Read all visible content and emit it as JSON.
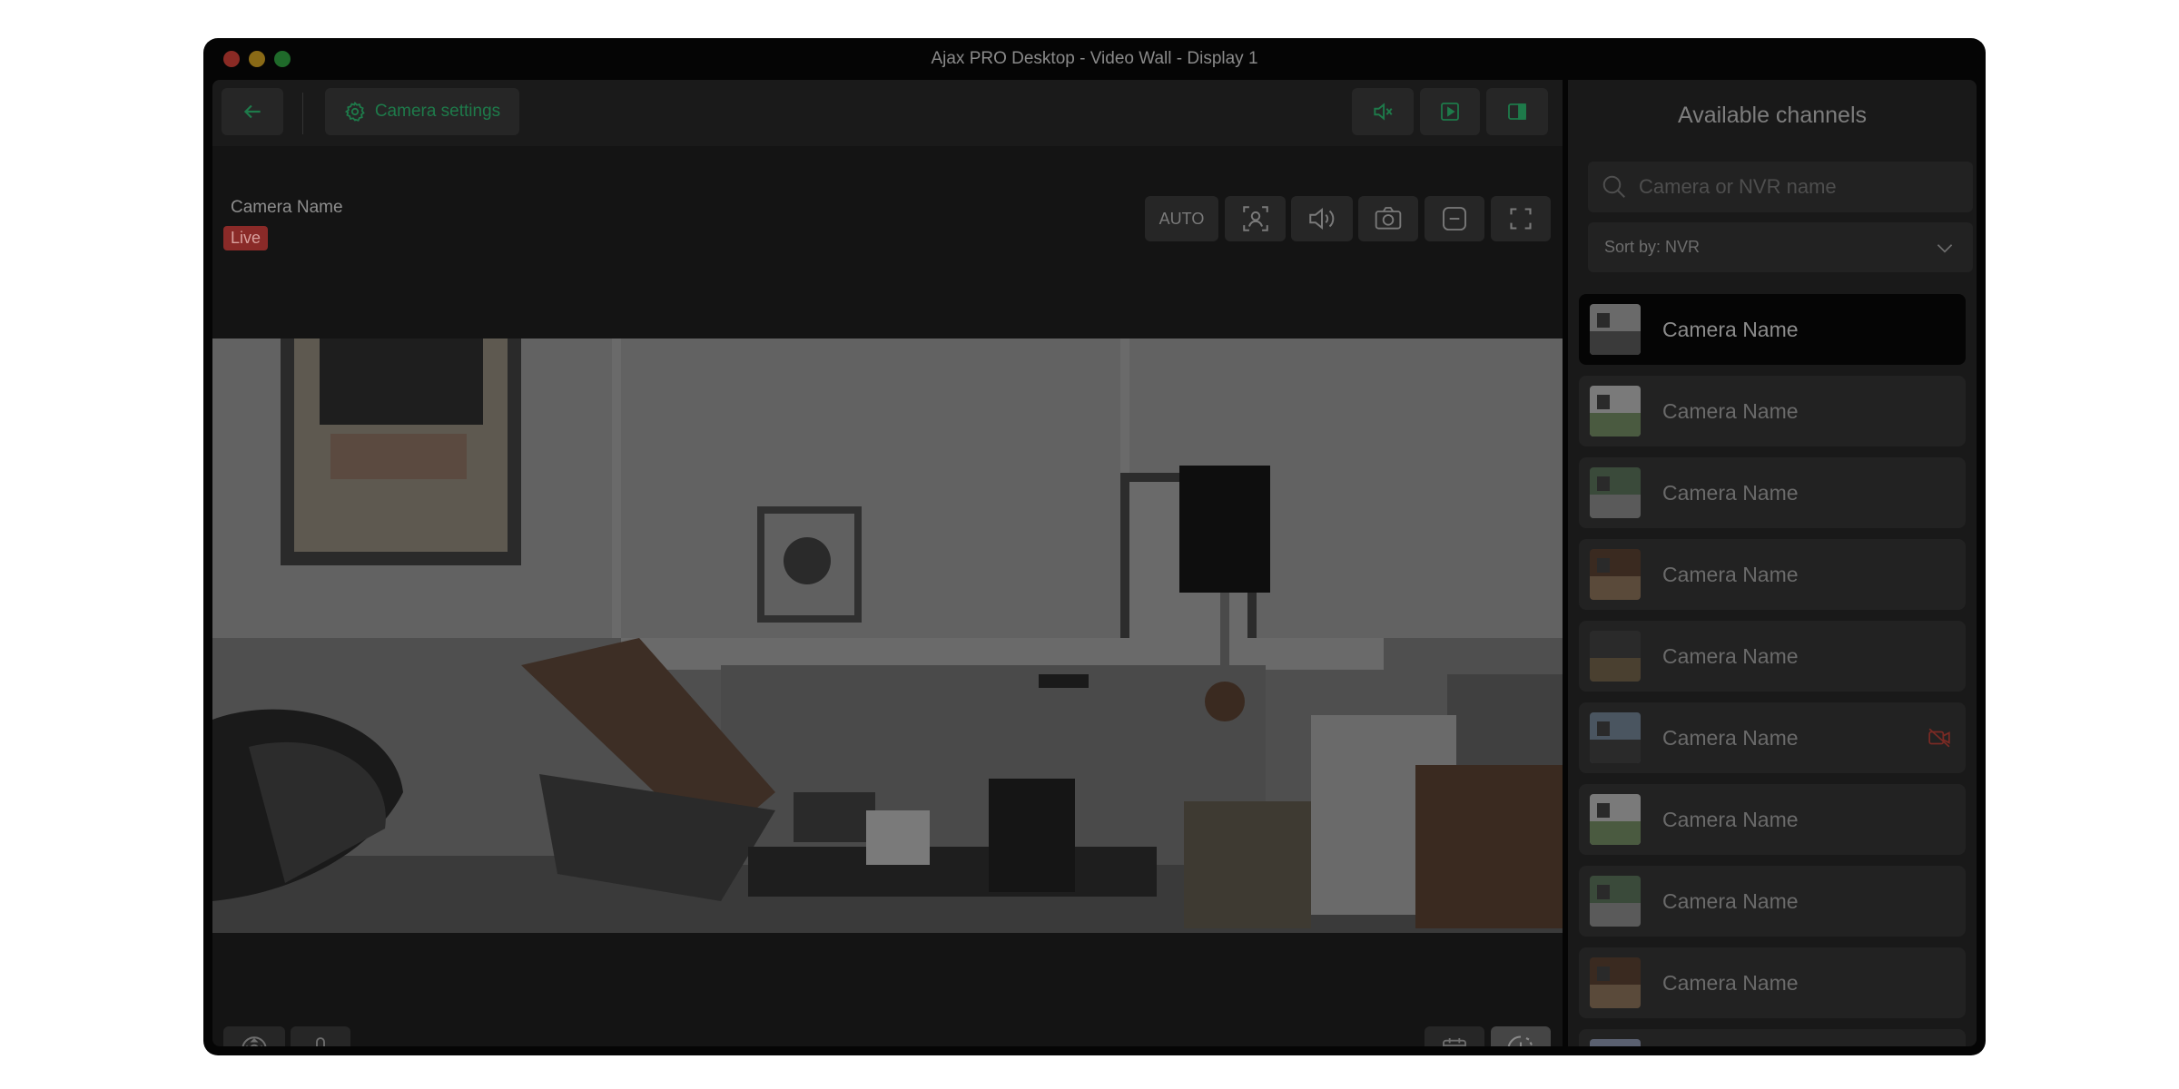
{
  "window": {
    "title": "Ajax PRO Desktop - Video Wall - Display 1",
    "traffic_colors": [
      "#8a2a24",
      "#8a6a16",
      "#1f6a2a"
    ]
  },
  "toolbar": {
    "camera_settings_label": "Camera settings",
    "accent_color": "#1e7a4a"
  },
  "video": {
    "camera_name": "Camera Name",
    "status_badge": "Live",
    "zoom_label": "AUTO"
  },
  "sidebar": {
    "title": "Available channels",
    "search_placeholder": "Camera or NVR name",
    "sort_label": "Sort by: NVR",
    "channels": [
      {
        "label": "Camera Name",
        "selected": true,
        "offline": false
      },
      {
        "label": "Camera Name",
        "selected": false,
        "offline": false
      },
      {
        "label": "Camera Name",
        "selected": false,
        "offline": false
      },
      {
        "label": "Camera Name",
        "selected": false,
        "offline": false
      },
      {
        "label": "Camera Name",
        "selected": false,
        "offline": false
      },
      {
        "label": "Camera Name",
        "selected": false,
        "offline": true
      },
      {
        "label": "Camera Name",
        "selected": false,
        "offline": false
      },
      {
        "label": "Camera Name",
        "selected": false,
        "offline": false
      },
      {
        "label": "Camera Name",
        "selected": false,
        "offline": false
      },
      {
        "label": "",
        "selected": false,
        "offline": false
      }
    ]
  },
  "icons": {
    "back": "arrow-left-icon",
    "settings": "gear-icon",
    "mute": "speaker-muted-icon",
    "play": "play-square-icon",
    "sidebar_toggle": "sidebar-panel-icon",
    "face_detect": "face-scan-icon",
    "volume": "speaker-icon",
    "snapshot": "camera-icon",
    "zoom_out": "minus-square-icon",
    "fullscreen": "fullscreen-icon",
    "ptz": "ptz-control-icon",
    "microphone": "microphone-icon",
    "calendar": "calendar-icon",
    "history": "clock-history-icon",
    "search": "search-icon",
    "dropdown": "chevron-down-icon",
    "camera_off": "camera-off-icon"
  }
}
